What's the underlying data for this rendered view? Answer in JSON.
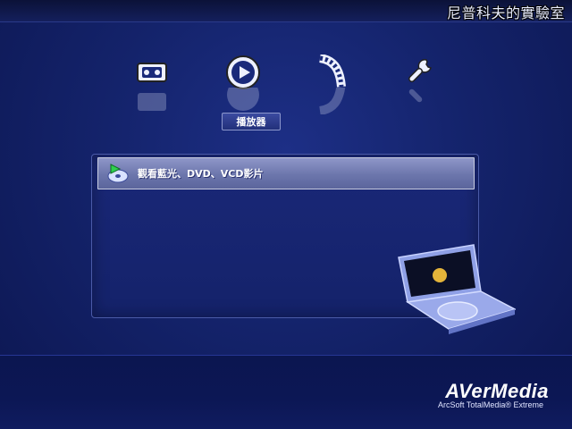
{
  "watermark": "尼普科夫的實驗室",
  "nav": {
    "items": [
      {
        "name": "tv-icon"
      },
      {
        "name": "play-icon"
      },
      {
        "name": "film-icon"
      },
      {
        "name": "wrench-icon"
      }
    ],
    "active_label": "播放器"
  },
  "panel": {
    "option_label": "觀看藍光、DVD、VCD影片"
  },
  "footer": {
    "brand": "AVerMedia",
    "subtitle": "ArcSoft TotalMedia® Extreme"
  }
}
